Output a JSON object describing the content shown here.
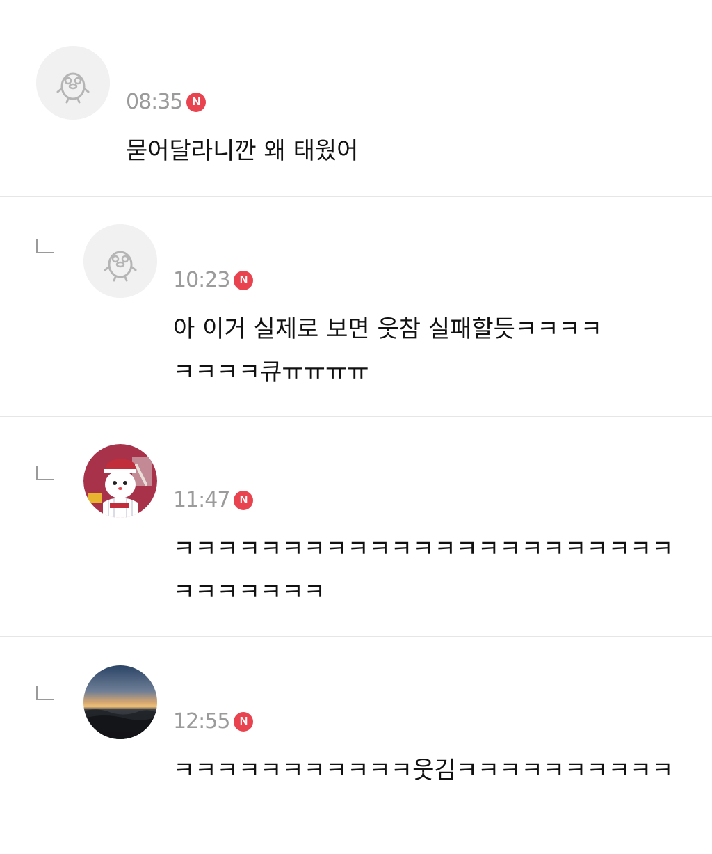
{
  "comments": [
    {
      "avatar": "default-duck-icon",
      "time": "08:35",
      "badge": "N",
      "is_reply": false,
      "text": "묻어달라니깐 왜 태웠어"
    },
    {
      "avatar": "default-duck-icon",
      "time": "10:23",
      "badge": "N",
      "is_reply": true,
      "text_line1": "아 이거 실제로 보면 웃참 실패할듯ㅋㅋㅋㅋ",
      "text_line2": "ㅋㅋㅋㅋ큐ㅠㅠㅠㅠ"
    },
    {
      "avatar": "mascot-cat-icon",
      "time": "11:47",
      "badge": "N",
      "is_reply": true,
      "text_line1": "ㅋㅋㅋㅋㅋㅋㅋㅋㅋㅋㅋㅋㅋㅋㅋㅋㅋㅋㅋㅋㅋㅋㅋ",
      "text_line2": "ㅋㅋㅋㅋㅋㅋㅋ"
    },
    {
      "avatar": "sunset-photo",
      "time": "12:55",
      "badge": "N",
      "is_reply": true,
      "text": "ㅋㅋㅋㅋㅋㅋㅋㅋㅋㅋㅋ웃김ㅋㅋㅋㅋㅋㅋㅋㅋㅋㅋ"
    }
  ],
  "colors": {
    "badge": "#e8434f",
    "time": "#9b9b9b",
    "divider": "#e6e6e6"
  }
}
